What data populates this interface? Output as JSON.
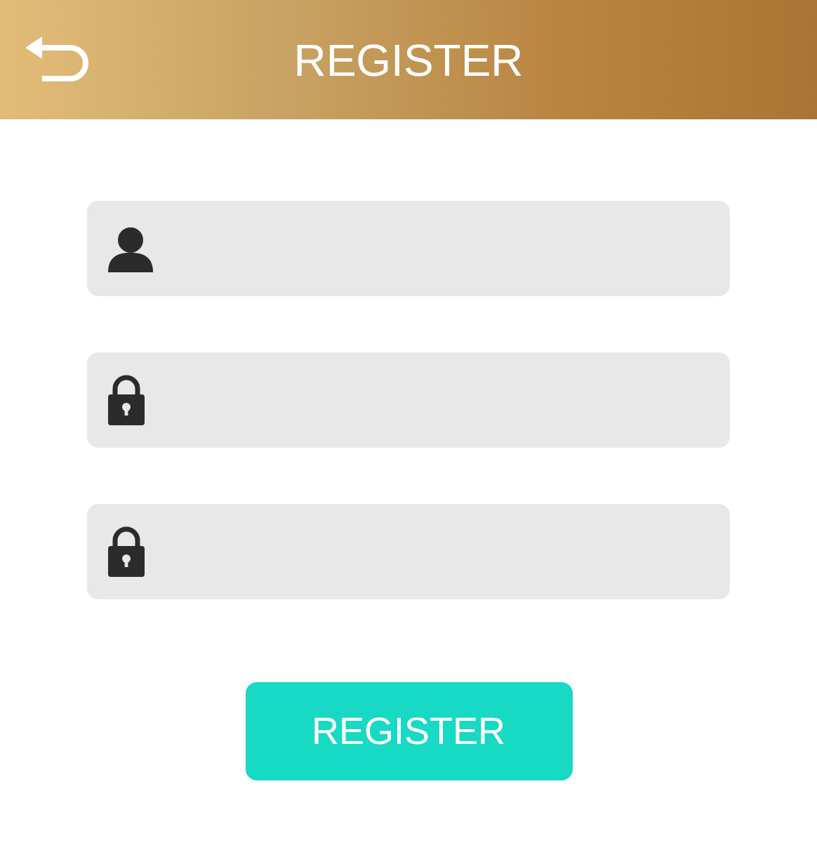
{
  "header": {
    "title": "REGISTER"
  },
  "fields": [
    {
      "kind": "user"
    },
    {
      "kind": "password"
    },
    {
      "kind": "password"
    }
  ],
  "submit_button": {
    "label": "REGISTER"
  }
}
